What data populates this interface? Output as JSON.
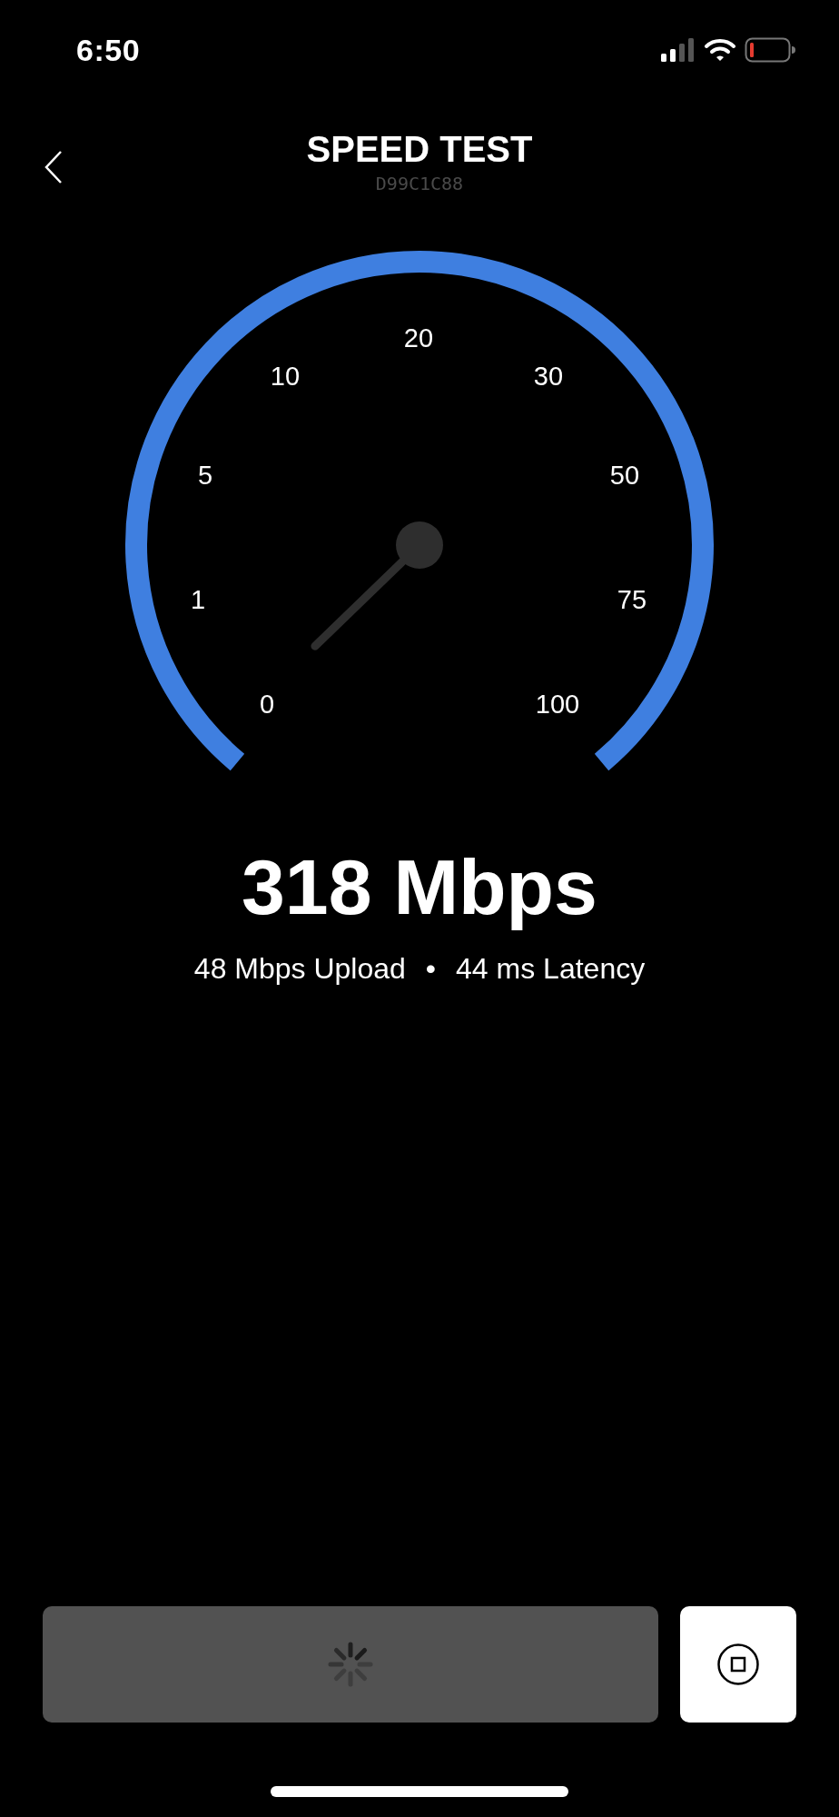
{
  "status_bar": {
    "time": "6:50"
  },
  "header": {
    "title": "SPEED TEST",
    "subtitle": "D99C1C88"
  },
  "gauge": {
    "labels": [
      "0",
      "1",
      "5",
      "10",
      "20",
      "30",
      "50",
      "75",
      "100"
    ]
  },
  "result": {
    "speed": "318 Mbps",
    "upload": "48 Mbps Upload",
    "separator": "•",
    "latency": "44 ms Latency"
  },
  "buttons": [
    {
      "kind": "loading"
    },
    {
      "kind": "stop"
    }
  ]
}
